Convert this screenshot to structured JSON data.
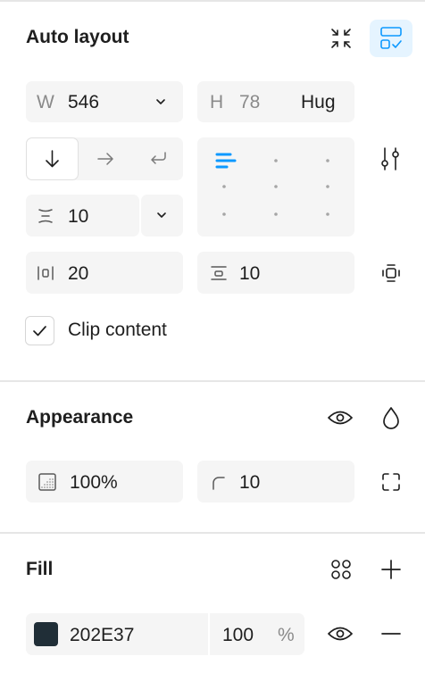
{
  "auto_layout": {
    "title": "Auto layout",
    "width_label": "W",
    "width_value": "546",
    "height_label": "H",
    "height_value": "78",
    "height_mode": "Hug",
    "gap_value": "10",
    "padding_horizontal": "20",
    "padding_vertical": "10",
    "clip_content_label": "Clip content",
    "clip_content_checked": true
  },
  "appearance": {
    "title": "Appearance",
    "opacity_value": "100%",
    "radius_value": "10"
  },
  "fill": {
    "title": "Fill",
    "hex_value": "202E37",
    "opacity_value": "100",
    "opacity_unit": "%",
    "swatch_color": "#202E37"
  },
  "colors": {
    "accent": "#0d99ff",
    "selected_button_bg": "#e5f4ff"
  }
}
